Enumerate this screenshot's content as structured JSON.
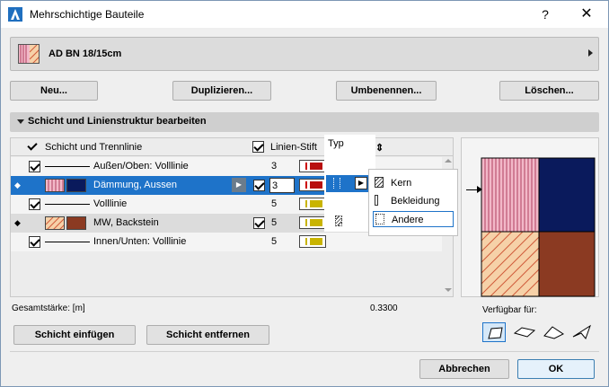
{
  "window": {
    "title": "Mehrschichtige Bauteile",
    "help": "?",
    "close": "✕"
  },
  "preset": {
    "name": "AD BN 18/15cm"
  },
  "top_buttons": {
    "new": "Neu...",
    "duplicate": "Duplizieren...",
    "rename": "Umbenennen...",
    "delete": "Löschen..."
  },
  "section": {
    "label": "Schicht und Linienstruktur bearbeiten"
  },
  "table": {
    "headers": {
      "layer": "Schicht und Trennlinie",
      "pen": "Linien-Stift",
      "type": "Typ"
    },
    "rows": [
      {
        "kind": "line",
        "label": "Außen/Oben: Volllinie",
        "pen": "3"
      },
      {
        "kind": "layer",
        "label": "Dämmung, Aussen",
        "pen": "3"
      },
      {
        "kind": "line",
        "label": "Volllinie",
        "pen": "5"
      },
      {
        "kind": "layer",
        "label": "MW, Backstein",
        "pen": "5"
      },
      {
        "kind": "line",
        "label": "Innen/Unten: Volllinie",
        "pen": "5"
      }
    ]
  },
  "type_menu": {
    "items": [
      "Kern",
      "Bekleidung",
      "Andere"
    ],
    "active": "Andere"
  },
  "total": {
    "label": "Gesamtstärke: [m]",
    "value": "0.3300"
  },
  "available": {
    "label": "Verfügbar für:"
  },
  "bottom_buttons": {
    "insert": "Schicht einfügen",
    "remove": "Schicht entfernen",
    "cancel": "Abbrechen",
    "ok": "OK"
  },
  "colors": {
    "selection": "#1e73c9",
    "insulation": "#f2b8c8",
    "brick": "#8b3a22",
    "core": "#0a1a5c",
    "pen_red": "#b80f0f",
    "pen_yellow": "#c9b400"
  }
}
